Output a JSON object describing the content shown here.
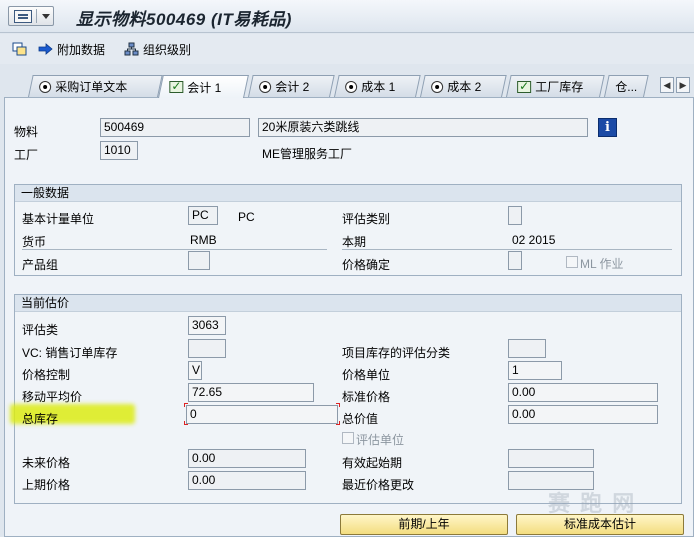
{
  "window": {
    "title": "显示物料500469 (IT易耗品)"
  },
  "toolbar": {
    "additional_data": "附加数据",
    "org_levels": "组织级别"
  },
  "tabs": [
    {
      "label": "采购订单文本",
      "icon": "radio-icon"
    },
    {
      "label": "会计 1",
      "icon": "check-icon",
      "active": true
    },
    {
      "label": "会计 2",
      "icon": "radio-icon"
    },
    {
      "label": "成本 1",
      "icon": "radio-icon"
    },
    {
      "label": "成本 2",
      "icon": "radio-icon"
    },
    {
      "label": "工厂库存",
      "icon": "check-icon"
    },
    {
      "label": "仓...",
      "icon": ""
    }
  ],
  "nav": {
    "left": "◀",
    "right": "▶"
  },
  "header": {
    "material_label": "物料",
    "material_value": "500469",
    "material_desc": "20米原装六类跳线",
    "plant_label": "工厂",
    "plant_value": "1010",
    "plant_desc": "ME管理服务工厂",
    "info_icon": "i"
  },
  "general": {
    "title": "一般数据",
    "base_uom_label": "基本计量单位",
    "base_uom_value": "PC",
    "base_uom_text": "PC",
    "valuation_category_label": "评估类别",
    "valuation_category_value": "",
    "currency_label": "货币",
    "currency_value": "RMB",
    "period_label": "本期",
    "period_value": "02 2015",
    "product_group_label": "产品组",
    "product_group_value": "",
    "price_determination_label": "价格确定",
    "price_determination_value": "",
    "ml_act_label": "ML 作业"
  },
  "valuation": {
    "title": "当前估价",
    "valuation_class_label": "评估类",
    "valuation_class_value": "3063",
    "vc_sales_order_label": "VC: 销售订单库存",
    "vc_sales_order_value": "",
    "project_stock_label": "项目库存的评估分类",
    "project_stock_value": "",
    "price_control_label": "价格控制",
    "price_control_value": "V",
    "price_unit_label": "价格单位",
    "price_unit_value": "1",
    "moving_avg_label": "移动平均价",
    "moving_avg_value": "72.65",
    "standard_price_label": "标准价格",
    "standard_price_value": "0.00",
    "total_stock_label": "总库存",
    "total_stock_value": "0",
    "total_value_label": "总价值",
    "total_value_value": "0.00",
    "valuated_unit_label": "评估单位",
    "future_price_label": "未来价格",
    "future_price_value": "0.00",
    "valid_from_label": "有效起始期",
    "valid_from_value": "",
    "prev_price_label": "上期价格",
    "prev_price_value": "0.00",
    "last_price_change_label": "最近价格更改",
    "last_price_change_value": ""
  },
  "buttons": {
    "prev_period": "前期/上年",
    "std_cost_est": "标准成本估计"
  },
  "watermark": "赛 跑 网",
  "colors": {
    "highlight": "#dceb14",
    "info_button": "#1b4aa6",
    "button_bg": "#f3dd80"
  }
}
